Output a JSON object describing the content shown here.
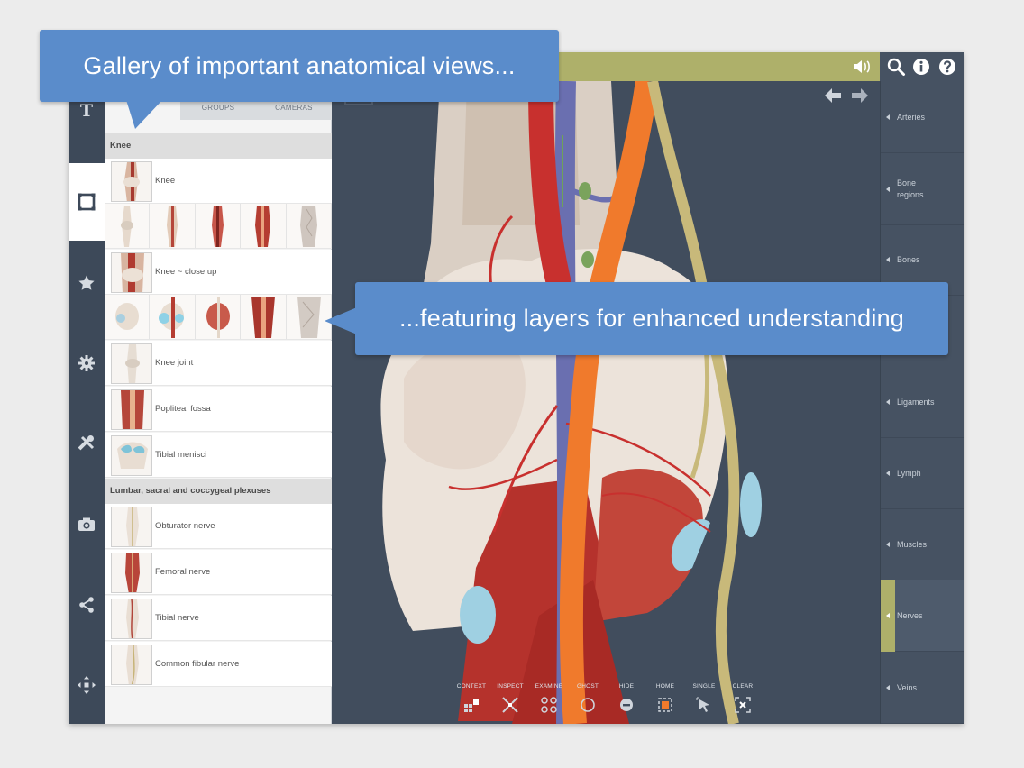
{
  "callouts": {
    "gallery": "Gallery of important anatomical views...",
    "layers": "...featuring layers for enhanced understanding"
  },
  "top_icons": [
    "volume-icon",
    "search-icon",
    "info-icon",
    "help-icon"
  ],
  "rail": {
    "items": [
      "text-icon",
      "gallery-icon",
      "star-icon",
      "gear-icon",
      "tools-icon",
      "camera-icon",
      "share-icon",
      "move-icon"
    ],
    "active": "gallery-icon"
  },
  "panel": {
    "tabs": [
      "GROUPS",
      "CAMERAS"
    ],
    "sections": [
      {
        "title": "Knee",
        "rows": [
          {
            "label": "Knee"
          },
          {
            "label": "Knee ~ close up"
          },
          {
            "label": "Knee joint"
          },
          {
            "label": "Popliteal fossa"
          },
          {
            "label": "Tibial menisci"
          }
        ]
      },
      {
        "title": "Lumbar, sacral and coccygeal plexuses",
        "rows": [
          {
            "label": "Obturator nerve"
          },
          {
            "label": "Femoral nerve"
          },
          {
            "label": "Tibial nerve"
          },
          {
            "label": "Common fibular nerve"
          }
        ]
      }
    ]
  },
  "layers": {
    "items": [
      "Arteries",
      "Bone regions",
      "Bones",
      "Ligaments",
      "Lymph",
      "Muscles",
      "Nerves",
      "Veins"
    ],
    "selected": "Nerves"
  },
  "toolbar": {
    "items": [
      "CONTEXT",
      "INSPECT",
      "EXAMINE",
      "GHOST",
      "HIDE",
      "HOME",
      "SINGLE",
      "CLEAR"
    ]
  },
  "colors": {
    "accent": "#aeb06a",
    "callout": "#5a8ccb",
    "panel_bg": "#465262",
    "artery": "#c8302e",
    "vein": "#6a6fb0",
    "nerve": "#c8b97a",
    "femoral_artery_highlight": "#f07a2c"
  }
}
